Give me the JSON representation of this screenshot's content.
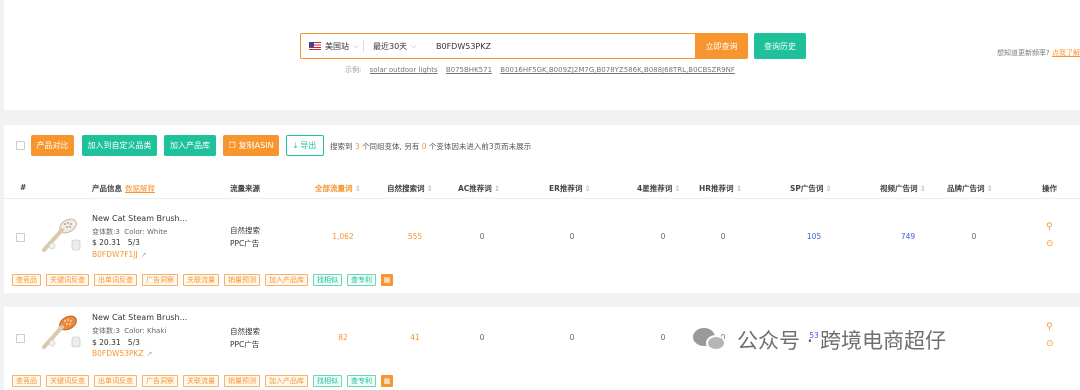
{
  "search": {
    "site_label": "美国站",
    "range_label": "最近30天",
    "query_value": "B0FDW53PKZ",
    "query_button": "立即查询",
    "history_button": "查询历史",
    "examples_label": "示例:",
    "examples": [
      "solar outdoor lights",
      "B075BHK571",
      "B0016HF5GK,B009ZJ2M7G,B078YZ586K,B088J68TRL,B0CBSZR9NF"
    ]
  },
  "update_notice": {
    "text": "想知道更新频率?",
    "link": "点我了解"
  },
  "toolbar": {
    "compare": "产品对比",
    "add_custom": "加入到自定义品类",
    "add_library": "加入产品库",
    "copy_asin": "复制ASIN",
    "export": "导出",
    "result": {
      "prefix": "搜索到",
      "count_a": "3",
      "mid": "个同组变体, 另有",
      "count_b": "0",
      "suffix": "个变体因未进入前3页而未展示"
    }
  },
  "columns": {
    "index": "#",
    "product": "产品信息",
    "product_sub": "数据解释",
    "source": "流量来源",
    "all_kw": "全部流量词",
    "organic": "自然搜索词",
    "ac": "AC推荐词",
    "er": "ER推荐词",
    "star4": "4星推荐词",
    "hr": "HR推荐词",
    "sp": "SP广告词",
    "video": "视频广告词",
    "brand": "品牌广告词",
    "ops": "操作"
  },
  "rows": [
    {
      "title": "New Cat Steam Brush...",
      "variants": "变体数:3",
      "color": "Color: White",
      "price": "$ 20.31",
      "rating": "5/3",
      "asin": "B0FDW7F1JJ",
      "sources": [
        "自然搜索",
        "PPC广告"
      ],
      "all_kw": "1,062",
      "organic": "555",
      "ac": "0",
      "er": "0",
      "star4": "0",
      "hr": "0",
      "sp": "105",
      "video": "749",
      "brand": "0"
    },
    {
      "title": "New Cat Steam Brush...",
      "variants": "变体数:3",
      "color": "Color: Khaki",
      "price": "$ 20.31",
      "rating": "5/3",
      "asin": "B0FDW53PKZ",
      "sources": [
        "自然搜索",
        "PPC广告"
      ],
      "all_kw": "82",
      "organic": "41",
      "ac": "0",
      "er": "0",
      "star4": "0",
      "hr": "0",
      "sp": "53",
      "video": "",
      "brand": ""
    }
  ],
  "tags": [
    "查竞品",
    "关键词反查",
    "出单词反查",
    "广告洞察",
    "关联流量",
    "销量预测",
    "加入产品库",
    "找相似",
    "查专利"
  ],
  "watermark": {
    "text": "公众号 · 跨境电商超仔"
  },
  "colors": {
    "accent": "#f7952f",
    "green": "#1ec199",
    "blue": "#3d5bd9"
  }
}
